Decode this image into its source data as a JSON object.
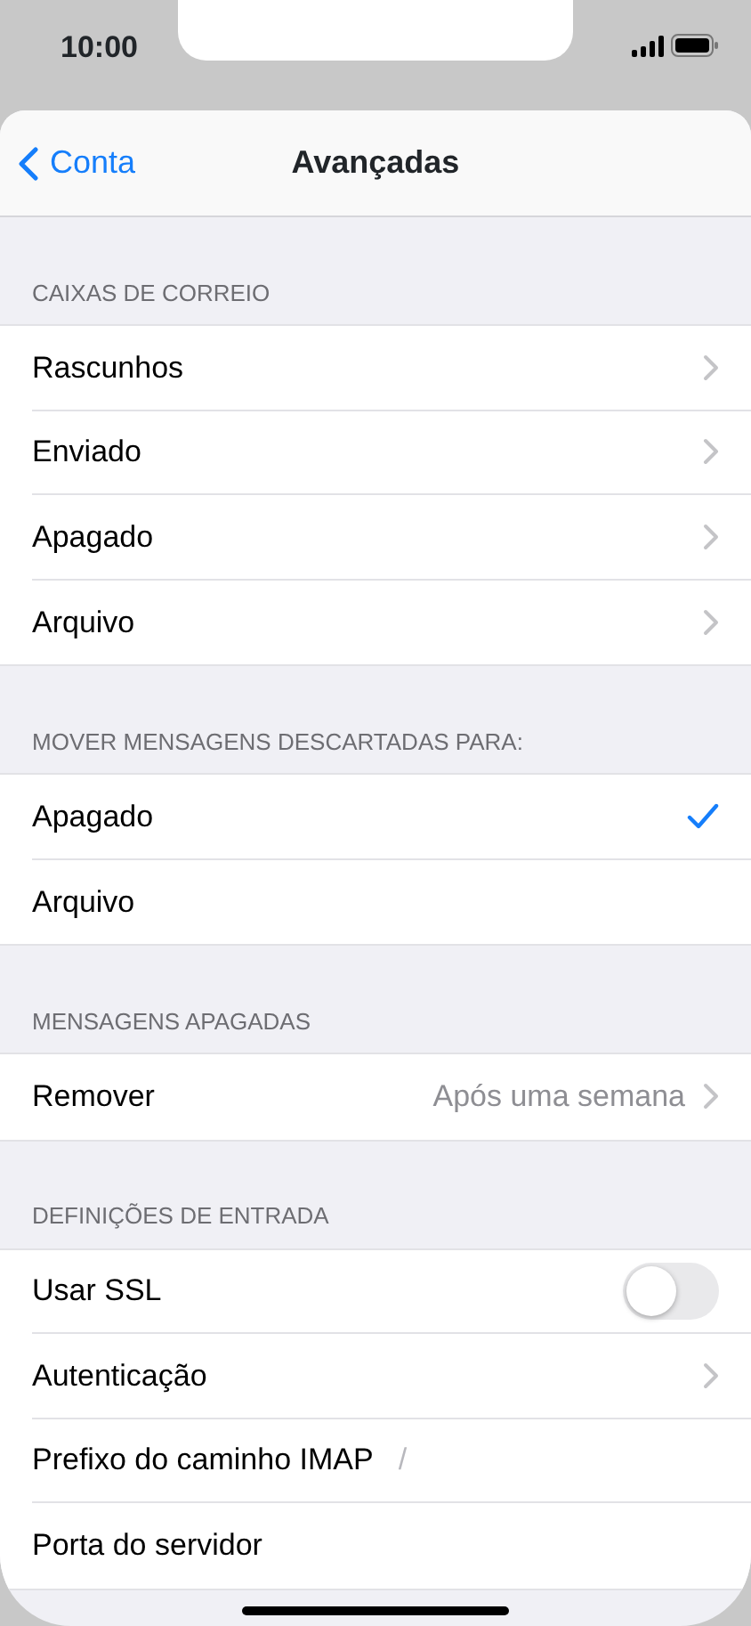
{
  "status_bar": {
    "time": "10:00"
  },
  "nav": {
    "back_label": "Conta",
    "title": "Avançadas"
  },
  "sections": [
    {
      "header": "CAIXAS DE CORREIO",
      "rows": [
        {
          "kind": "link",
          "label": "Rascunhos"
        },
        {
          "kind": "link",
          "label": "Enviado"
        },
        {
          "kind": "link",
          "label": "Apagado"
        },
        {
          "kind": "link",
          "label": "Arquivo"
        }
      ]
    },
    {
      "header": "MOVER MENSAGENS DESCARTADAS PARA:",
      "rows": [
        {
          "kind": "choice",
          "label": "Apagado",
          "selected": true
        },
        {
          "kind": "choice",
          "label": "Arquivo",
          "selected": false
        }
      ]
    },
    {
      "header": "MENSAGENS APAGADAS",
      "rows": [
        {
          "kind": "link",
          "label": "Remover",
          "value": "Após uma semana"
        }
      ]
    },
    {
      "header": "DEFINIÇÕES DE ENTRADA",
      "rows": [
        {
          "kind": "toggle",
          "label": "Usar SSL",
          "on": false
        },
        {
          "kind": "link",
          "label": "Autenticação"
        },
        {
          "kind": "field",
          "label": "Prefixo do caminho IMAP",
          "placeholder": "/"
        },
        {
          "kind": "field",
          "label": "Porta do servidor"
        }
      ]
    }
  ]
}
